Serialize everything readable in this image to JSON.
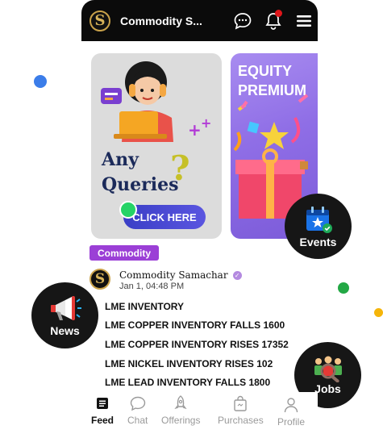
{
  "header": {
    "title": "Commodity S...",
    "logo_letter": "S"
  },
  "banners": [
    {
      "line1": "Any",
      "line2": "Queries",
      "qmark": "?",
      "button": "CLICK HERE"
    },
    {
      "line1": "EQUITY",
      "line2": "PREMIUM"
    }
  ],
  "floating": {
    "events": "Events",
    "news": "News",
    "jobs": "Jobs"
  },
  "post": {
    "tag": "Commodity",
    "author": "Commodity Samachar",
    "date": "Jan 1, 04:48 PM",
    "lines": [
      "LME INVENTORY",
      "LME COPPER INVENTORY FALLS 1600",
      "LME COPPER INVENTORY RISES 17352",
      "LME NICKEL INVENTORY RISES 102",
      "LME LEAD INVENTORY FALLS 1800"
    ]
  },
  "nav": {
    "feed": "Feed",
    "chat": "Chat",
    "offerings": "Offerings",
    "purchases": "Purchases",
    "profile": "Profile"
  },
  "colors": {
    "accent": "#9b3fd6",
    "notification": "#e0161a",
    "gold": "#c9a24a"
  }
}
